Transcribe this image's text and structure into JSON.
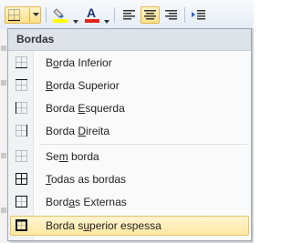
{
  "menu": {
    "title": "Bordas",
    "items": [
      {
        "pre": "B",
        "acc": "o",
        "post": "rda Inferior"
      },
      {
        "pre": "",
        "acc": "B",
        "post": "orda Superior"
      },
      {
        "pre": "Borda ",
        "acc": "E",
        "post": "squerda"
      },
      {
        "pre": "Borda ",
        "acc": "D",
        "post": "ireita"
      },
      {
        "pre": "Se",
        "acc": "m",
        "post": " borda"
      },
      {
        "pre": "",
        "acc": "T",
        "post": "odas as bordas"
      },
      {
        "pre": "Bord",
        "acc": "a",
        "post": "s Externas"
      },
      {
        "pre": "Borda s",
        "acc": "u",
        "post": "perior espessa"
      }
    ]
  },
  "icons": {
    "toolbar": [
      "borders-icon",
      "dropdown-arrow-icon",
      "highlight-color-icon",
      "font-color-icon",
      "align-left-icon",
      "align-center-icon",
      "align-right-icon",
      "indent-icon"
    ],
    "menu": [
      "border-bottom-icon",
      "border-top-icon",
      "border-left-icon",
      "border-right-icon",
      "no-border-icon",
      "all-borders-icon",
      "outside-borders-icon",
      "thick-top-border-icon"
    ]
  },
  "colors": {
    "highlight_fill": "#fde8a3",
    "highlight_border": "#e5c365",
    "font_color_bar": "#e0241b",
    "highlighter_bar": "#ffff00"
  }
}
